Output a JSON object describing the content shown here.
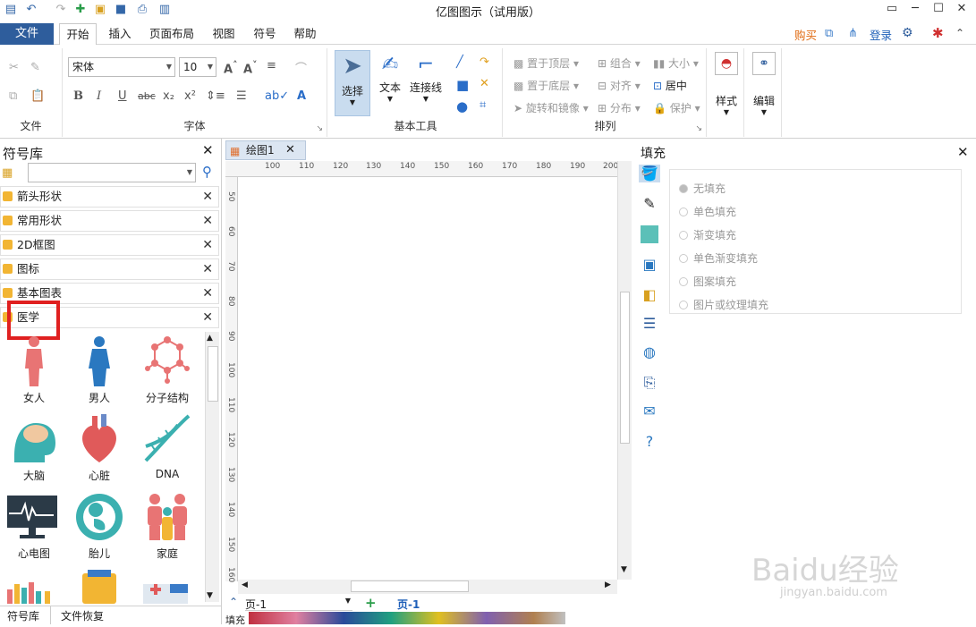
{
  "app_title": "亿图图示（试用版）",
  "menu": {
    "file": "文件",
    "tabs": [
      "开始",
      "插入",
      "页面布局",
      "视图",
      "符号",
      "帮助"
    ],
    "buy": "购买",
    "login": "登录"
  },
  "ribbon": {
    "groups": {
      "file": "文件",
      "font": "字体",
      "basic_tools": "基本工具",
      "arrange": "排列"
    },
    "font_name": "宋体",
    "font_size": "10",
    "select": "选择",
    "text": "文本",
    "connector": "连接线",
    "arrange_items": [
      "置于顶层",
      "组合",
      "大小",
      "置于底层",
      "对齐",
      "居中",
      "旋转和镜像",
      "分布",
      "保护"
    ],
    "style": "样式",
    "edit": "编辑"
  },
  "library": {
    "title": "符号库",
    "search_placeholder": "",
    "categories": [
      "箭头形状",
      "常用形状",
      "2D框图",
      "图标",
      "基本图表",
      "医学"
    ],
    "symbols": [
      "女人",
      "男人",
      "分子结构",
      "大脑",
      "心脏",
      "DNA",
      "心电图",
      "胎儿",
      "家庭"
    ],
    "bottom_tabs": [
      "符号库",
      "文件恢复"
    ]
  },
  "document": {
    "tab": "绘图1",
    "ruler_h": [
      "100",
      "110",
      "120",
      "130",
      "140",
      "150",
      "160",
      "170",
      "180",
      "190",
      "200"
    ],
    "ruler_v": [
      "50",
      "60",
      "70",
      "80",
      "90",
      "100",
      "110",
      "120",
      "130",
      "140",
      "150",
      "160"
    ],
    "page_select": "页-1",
    "page_tab": "页-1",
    "fill_label": "填充"
  },
  "fill_panel": {
    "title": "填充",
    "options": [
      "无填充",
      "单色填充",
      "渐变填充",
      "单色渐变填充",
      "图案填充",
      "图片或纹理填充"
    ],
    "selected": "无填充"
  },
  "watermark": {
    "main": "Baidu经验",
    "sub": "jingyan.baidu.com"
  },
  "colors": {
    "accent": "#2e5d9c",
    "highlight_box": "#e02020",
    "buy": "#e06a10",
    "login": "#1e5fb8"
  }
}
